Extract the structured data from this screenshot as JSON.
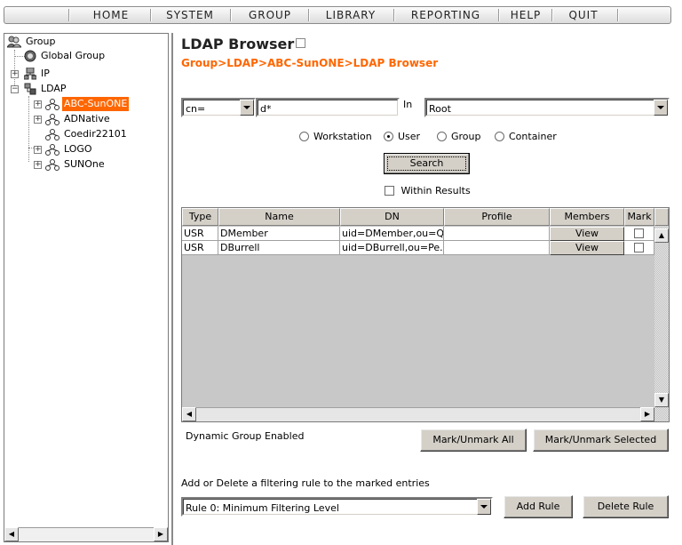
{
  "menu": {
    "items": [
      "HOME",
      "SYSTEM",
      "GROUP",
      "LIBRARY",
      "REPORTING",
      "HELP",
      "QUIT"
    ]
  },
  "tree": {
    "root": "Group",
    "global_group": "Global Group",
    "ip": "IP",
    "ldap": "LDAP",
    "servers": [
      "ABC-SunONE",
      "ADNative",
      "Coedir22101",
      "LOGO",
      "SUNOne"
    ],
    "selected": "ABC-SunONE"
  },
  "page": {
    "title": "LDAP Browser",
    "breadcrumb": "Group>LDAP>ABC-SunONE>LDAP Browser"
  },
  "search": {
    "attribute": "cn=",
    "query": "d*",
    "in_label": "In",
    "scope": "Root",
    "radios": [
      {
        "label": "Workstation",
        "checked": false
      },
      {
        "label": "User",
        "checked": true
      },
      {
        "label": "Group",
        "checked": false
      },
      {
        "label": "Container",
        "checked": false
      }
    ],
    "search_button": "Search",
    "within_results": "Within Results"
  },
  "table": {
    "columns": [
      "Type",
      "Name",
      "DN",
      "Profile",
      "Members",
      "Mark"
    ],
    "rows": [
      {
        "type": "USR",
        "name": "DMember",
        "dn": "uid=DMember,ou=Q...",
        "profile": "",
        "members": "View",
        "marked": false
      },
      {
        "type": "USR",
        "name": "DBurrell",
        "dn": "uid=DBurrell,ou=Pe...",
        "profile": "",
        "members": "View",
        "marked": false
      }
    ]
  },
  "footer": {
    "dynamic_status": "Dynamic Group Enabled",
    "mark_all": "Mark/Unmark All",
    "mark_selected": "Mark/Unmark Selected",
    "rule_instruction": "Add or Delete a filtering rule to the marked entries",
    "rule_selected": "Rule 0: Minimum Filtering Level",
    "add_rule": "Add Rule",
    "delete_rule": "Delete Rule"
  },
  "colors": {
    "accent": "#ff6600",
    "chrome": "#d4d0c8"
  }
}
